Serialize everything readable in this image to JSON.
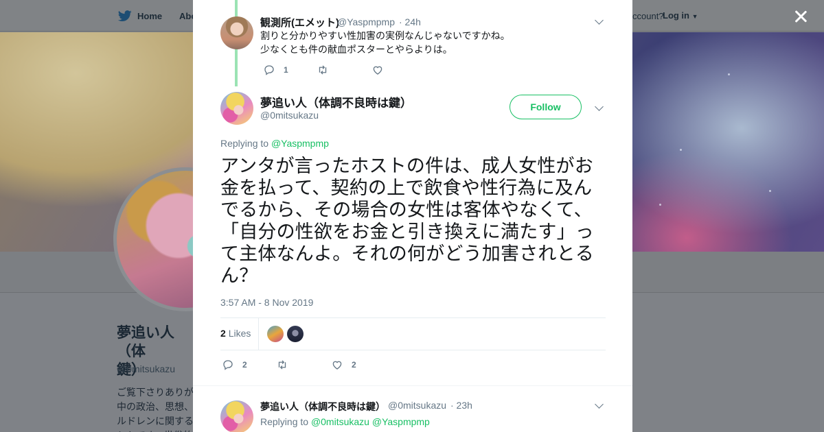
{
  "nav": {
    "home_label": "Home",
    "about_label": "Abo",
    "account_text": "ccount?",
    "login_label": "Log in"
  },
  "profile": {
    "name": "夢追い人（体",
    "name_line2": "鍵）",
    "handle": "@0mitsukazu",
    "bio": "ご覧下さりありが\n中の政治、思想、\nルドレンに関する\nシトです。世俗的"
  },
  "parent_tweet": {
    "name": "観測所(エメット)",
    "handle": "@Yaspmpmp",
    "time": "· 24h",
    "text_line1": "割りと分かりやすい性加害の実例なんじゃないですかね。",
    "text_line2": "少なくとも件の献血ポスターとやらよりは。",
    "reply_count": "1"
  },
  "main_tweet": {
    "name": "夢追い人（体調不良時は鍵）",
    "handle": "@0mitsukazu",
    "follow_label": "Follow",
    "replying_prefix": "Replying to",
    "replying_to": "@Yaspmpmp",
    "text": "アンタが言ったホストの件は、成人女性がお金を払って、契約の上で飲食や性行為に及んでるから、その場合の女性は客体やなくて、「自分の性欲をお金と引き換えに満たす」って主体なんよ。それの何がどう加害されとるん？",
    "timestamp": "3:57 AM - 8 Nov 2019",
    "likes_count": "2",
    "likes_label": "Likes",
    "reply_count": "2",
    "like_action_count": "2"
  },
  "reply_tweet": {
    "name": "夢追い人（体調不良時は鍵）",
    "handle": "@0mitsukazu",
    "time": "· 23h",
    "replying_prefix": "Replying to",
    "replying_to_1": "@0mitsukazu",
    "replying_to_2": "@Yaspmpmp"
  },
  "colors": {
    "twitter_blue": "#1da1f2",
    "follow_green": "#17bf63",
    "thread_line": "#9be3b4",
    "secondary_text": "#657786"
  }
}
